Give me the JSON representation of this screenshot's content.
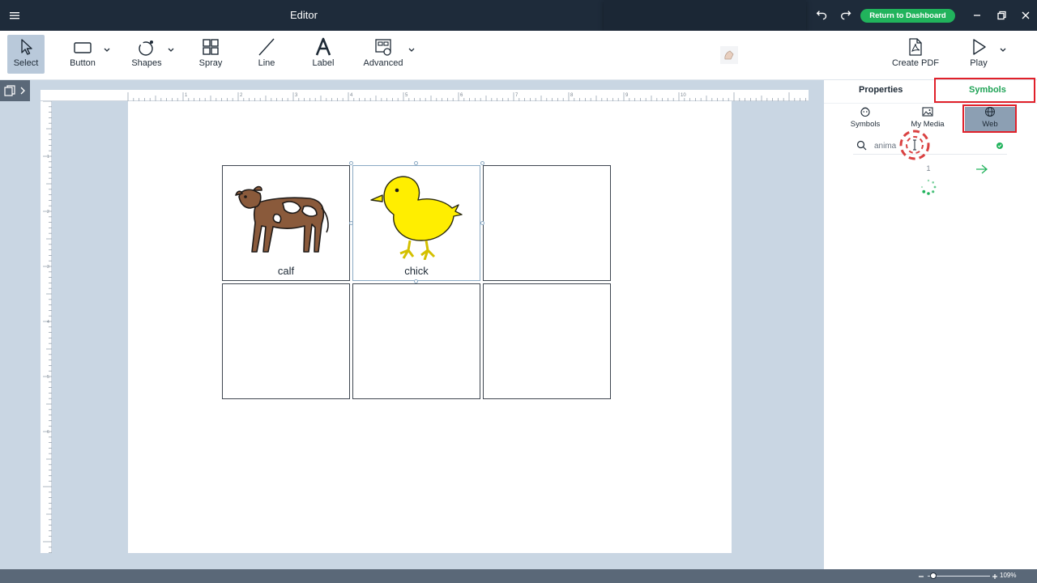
{
  "window": {
    "title": "Editor",
    "return_button": "Return to Dashboard"
  },
  "toolbar": {
    "tools": [
      {
        "label": "Select",
        "icon": "cursor-arrow-icon",
        "active": true
      },
      {
        "label": "Button",
        "icon": "rectangle-icon"
      },
      {
        "label": "Shapes",
        "icon": "shapes-icon"
      },
      {
        "label": "Spray",
        "icon": "grid-four-icon"
      },
      {
        "label": "Line",
        "icon": "line-icon"
      },
      {
        "label": "Label",
        "icon": "letter-a-icon"
      },
      {
        "label": "Advanced",
        "icon": "advanced-icon"
      },
      {
        "label": "Create PDF",
        "icon": "pdf-icon"
      },
      {
        "label": "Play",
        "icon": "play-icon"
      }
    ]
  },
  "ruler": {
    "ticks": [
      "1",
      "2",
      "3",
      "4",
      "5",
      "6",
      "7",
      "8",
      "9",
      "10"
    ],
    "vticks": [
      "1",
      "2",
      "3",
      "4",
      "5",
      "6"
    ]
  },
  "grid": {
    "cells": [
      {
        "label": "calf",
        "image": "calf-picture"
      },
      {
        "label": "chick",
        "image": "chick-picture",
        "selected": true
      },
      {
        "label": ""
      },
      {
        "label": ""
      },
      {
        "label": ""
      },
      {
        "label": ""
      }
    ]
  },
  "panel": {
    "tabs": [
      {
        "label": "Properties",
        "active": false
      },
      {
        "label": "Symbols",
        "active": true,
        "color": "#1fa356"
      }
    ],
    "sources": [
      {
        "label": "Symbols",
        "icon": "symbol-face-icon"
      },
      {
        "label": "My Media",
        "icon": "image-icon"
      },
      {
        "label": "Web",
        "icon": "globe-icon",
        "active": true
      }
    ],
    "search": {
      "value": "anima",
      "placeholder": ""
    },
    "page_number": "1",
    "highlight_color": "#e0202a"
  },
  "zoom": {
    "label": "109%",
    "level_percent": 109
  },
  "colors": {
    "titlebar": "#1e2b3a",
    "accent": "#21b35c",
    "canvas_bg": "#c9d6e3"
  }
}
